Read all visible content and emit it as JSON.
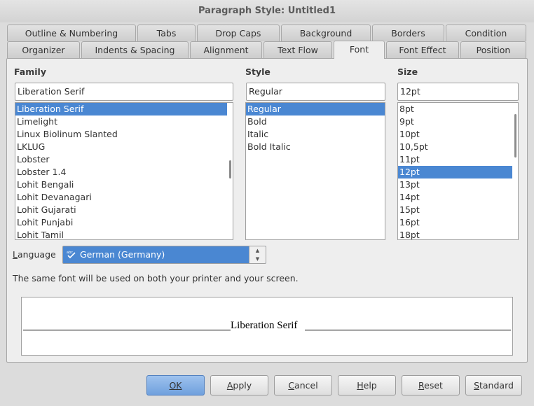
{
  "window": {
    "title": "Paragraph Style: Untitled1"
  },
  "tabs_row1": [
    "Outline & Numbering",
    "Tabs",
    "Drop Caps",
    "Background",
    "Borders",
    "Condition"
  ],
  "tabs_row2": [
    "Organizer",
    "Indents & Spacing",
    "Alignment",
    "Text Flow",
    "Font",
    "Font Effect",
    "Position"
  ],
  "active_tab": "Font",
  "family": {
    "label": "Family",
    "value": "Liberation Serif",
    "items": [
      "Liberation Serif",
      "Limelight",
      "Linux Biolinum Slanted",
      "LKLUG",
      "Lobster",
      "Lobster 1.4",
      "Lohit Bengali",
      "Lohit Devanagari",
      "Lohit Gujarati",
      "Lohit Punjabi",
      "Lohit Tamil"
    ],
    "selected": "Liberation Serif"
  },
  "style": {
    "label": "Style",
    "value": "Regular",
    "items": [
      "Regular",
      "Bold",
      "Italic",
      "Bold Italic"
    ],
    "selected": "Regular"
  },
  "size": {
    "label": "Size",
    "value": "12pt",
    "items": [
      "8pt",
      "9pt",
      "10pt",
      "10,5pt",
      "11pt",
      "12pt",
      "13pt",
      "14pt",
      "15pt",
      "16pt",
      "18pt"
    ],
    "selected": "12pt"
  },
  "language": {
    "label": "Language",
    "value": "German (Germany)"
  },
  "info": "The same font will be used on both your printer and your screen.",
  "preview": {
    "text": "Liberation Serif"
  },
  "buttons": {
    "ok": "OK",
    "apply": "Apply",
    "cancel": "Cancel",
    "help": "Help",
    "reset": "Reset",
    "standard": "Standard"
  },
  "colors": {
    "selection": "#4a87d2",
    "background": "#eeeeee"
  }
}
